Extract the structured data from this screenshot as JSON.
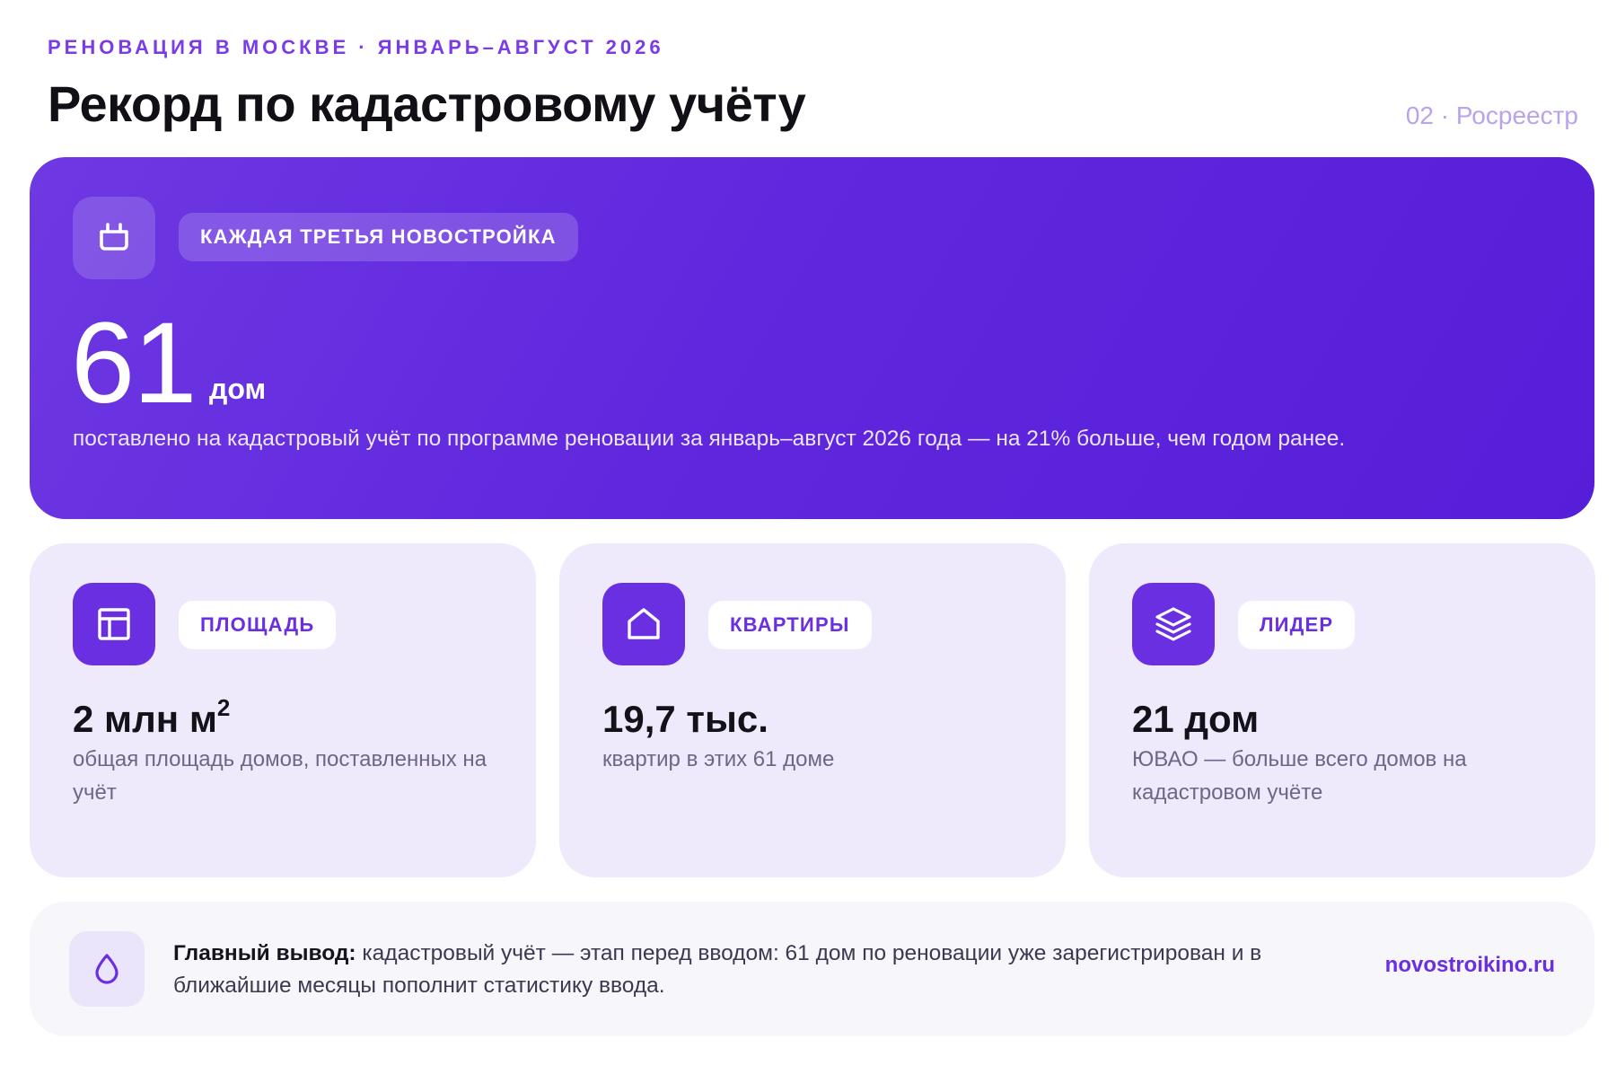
{
  "header": {
    "eyebrow": "РЕНОВАЦИЯ В МОСКВЕ · ЯНВАРЬ–АВГУСТ 2026",
    "title": "Рекорд по кадастровому учёту",
    "page_meta": "02 · Росреестр"
  },
  "hero": {
    "icon": "plug-icon",
    "chip": "КАЖДАЯ ТРЕТЬЯ НОВОСТРОЙКА",
    "number": "61",
    "unit": "дом",
    "caption": "поставлено на кадастровый учёт по программе реновации за январь–август 2026 года — на 21% больше, чем годом ранее."
  },
  "stats": [
    {
      "icon": "layout-icon",
      "chip": "ПЛОЩАДЬ",
      "value": "2 млн м",
      "value_sup": "2",
      "desc": "общая площадь домов, поставленных на учёт"
    },
    {
      "icon": "house-icon",
      "chip": "КВАРТИРЫ",
      "value": "19,7 тыс.",
      "desc": "квартир в этих 61 доме"
    },
    {
      "icon": "layers-icon",
      "chip": "ЛИДЕР",
      "value": "21 дом",
      "desc": "ЮВАО — больше всего домов на кадастровом учёте"
    }
  ],
  "conclusion": {
    "icon": "drop-icon",
    "lead": "Главный вывод:",
    "text": " кадастровый учёт — этап перед вводом: 61 дом по реновации уже зарегистрирован и в ближайшие месяцы пополнит статистику ввода.",
    "site": "novostroikino.ru"
  },
  "colors": {
    "accent": "#6a2fe0",
    "hero_start": "#6e38e2",
    "hero_end": "#571ed9",
    "card_bg": "#efe9fc",
    "muted_meta": "#b9a3ec"
  }
}
